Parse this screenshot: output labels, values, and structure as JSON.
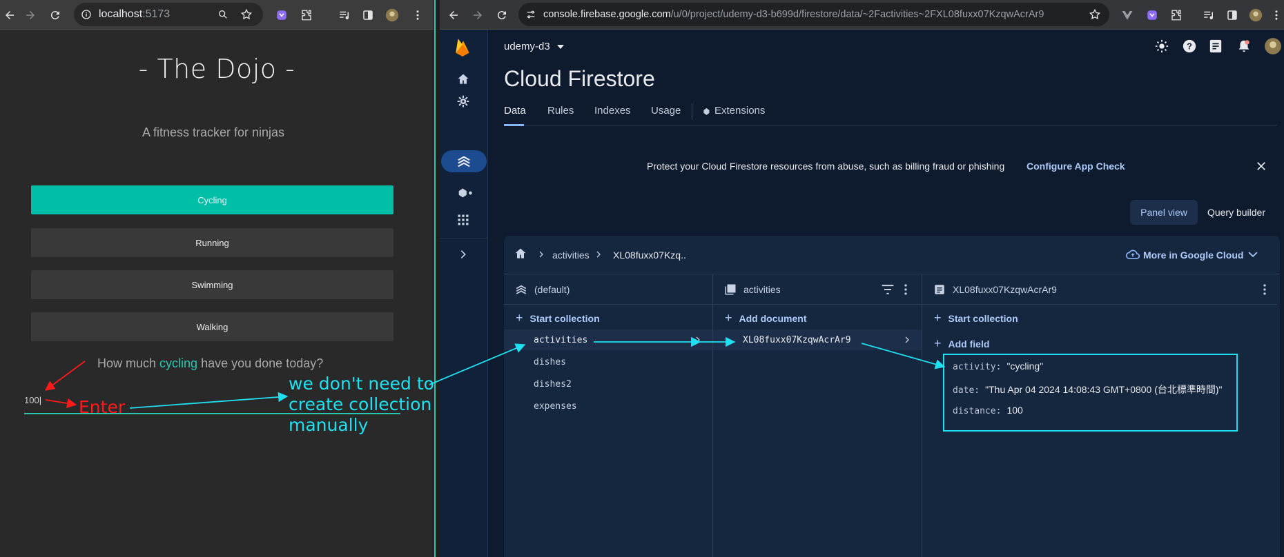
{
  "left_browser": {
    "url_host": "localhost",
    "url_port": ":5173",
    "app": {
      "title": "- The Dojo -",
      "subtitle": "A fitness tracker for ninjas",
      "activities": [
        "Cycling",
        "Running",
        "Swimming",
        "Walking"
      ],
      "selected_activity": "Cycling",
      "question_before": "How much",
      "question_highlight": "cycling",
      "question_after": "have you done today?",
      "amount_value": "100"
    }
  },
  "right_browser": {
    "url_host": "console.firebase.google.com",
    "url_path": "/u/0/project/udemy-d3-b699d/firestore/data/~2Factivities~2FXL08fuxx07KzqwAcrAr9",
    "project_name": "udemy-d3",
    "page_title": "Cloud Firestore",
    "tabs": [
      "Data",
      "Rules",
      "Indexes",
      "Usage",
      "Extensions"
    ],
    "banner_text": "Protect your Cloud Firestore resources from abuse, such as billing fraud or phishing",
    "banner_link": "Configure App Check",
    "view_panel": "Panel view",
    "view_query": "Query builder",
    "breadcrumb": [
      "activities",
      "XL08fuxx07Kzq.."
    ],
    "more_google_cloud": "More in Google Cloud",
    "columns": {
      "root": {
        "title": "(default)",
        "add_label": "Start collection",
        "items": [
          "activities",
          "dishes",
          "dishes2",
          "expenses"
        ]
      },
      "collection": {
        "title": "activities",
        "add_label": "Add document",
        "items": [
          "XL08fuxx07KzqwAcrAr9"
        ]
      },
      "document": {
        "title": "XL08fuxx07KzqwAcrAr9",
        "add_collection": "Start collection",
        "add_field": "Add field",
        "fields": [
          {
            "key": "activity:",
            "value": "\"cycling\""
          },
          {
            "key": "date:",
            "value": "\"Thu Apr 04 2024 14:08:43 GMT+0800 (台北標準時間)\""
          },
          {
            "key": "distance:",
            "value": "100"
          }
        ]
      }
    }
  },
  "annotations": {
    "enter_label": "Enter",
    "note_lines": [
      "we don't need to",
      "create collection",
      "manually"
    ]
  },
  "colors": {
    "accent_teal": "#00bfa6",
    "annotation_cyan": "#1fe0f0",
    "annotation_red": "#ff1a1a",
    "firebase_link": "#aecbfa"
  }
}
